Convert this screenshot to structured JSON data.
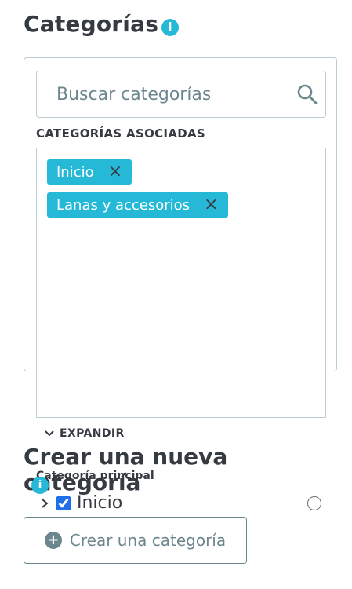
{
  "header": {
    "title": "Categorías",
    "info_icon": "i"
  },
  "search": {
    "placeholder": "Buscar categorías"
  },
  "associated": {
    "label": "CATEGORÍAS ASOCIADAS",
    "tags": [
      {
        "label": "Inicio",
        "remove": "×"
      },
      {
        "label": "Lanas y accesorios",
        "remove": "×"
      }
    ]
  },
  "expand": {
    "label": "EXPANDIR"
  },
  "create": {
    "heading": "Crear una nueva categoría",
    "parent_label": "Categoría principal",
    "tree": [
      {
        "label": "Inicio",
        "checked": true
      }
    ],
    "button_label": "Crear una categoría"
  },
  "colors": {
    "accent": "#25b9d7",
    "text": "#363a41",
    "muted": "#6c868e",
    "border": "#bbcdd2"
  }
}
